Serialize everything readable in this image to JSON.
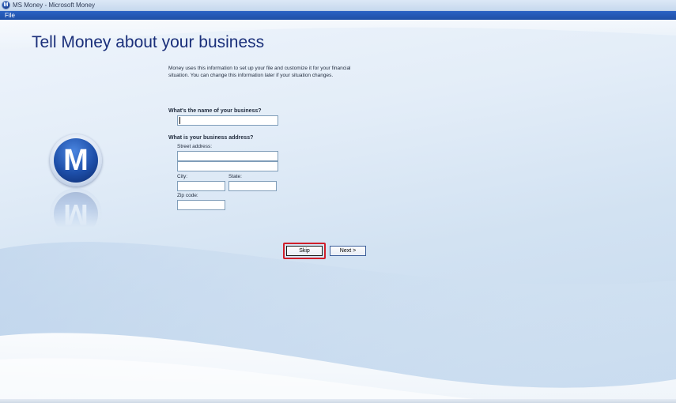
{
  "window": {
    "title": "MS Money - Microsoft Money",
    "app_icon": "money-logo-icon"
  },
  "menu": {
    "items": [
      {
        "label": "File"
      }
    ]
  },
  "page": {
    "title": "Tell Money about your business",
    "intro": "Money uses this information to set up your file and customize it for your financial situation. You can change this information later if your situation changes.",
    "logo_letter": "M"
  },
  "form": {
    "business_name": {
      "question": "What's the name of your business?",
      "value": ""
    },
    "address": {
      "question": "What is your business address?",
      "street_label": "Street address:",
      "street_line1": "",
      "street_line2": "",
      "city_label": "City:",
      "city": "",
      "state_label": "State:",
      "state": "",
      "zip_label": "Zip code:",
      "zip": ""
    }
  },
  "buttons": {
    "skip": "Skip",
    "next": "Next >"
  },
  "colors": {
    "title": "#1a2f7a",
    "menubar": "#2a62c4",
    "highlight": "#d01f2a"
  }
}
